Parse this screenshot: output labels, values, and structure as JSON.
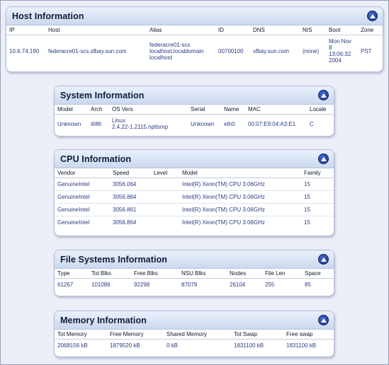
{
  "host": {
    "title": "Host Information",
    "headers": [
      "IP",
      "Host",
      "Alias",
      "ID",
      "DNS",
      "NIS",
      "Boot",
      "Zone"
    ],
    "row": {
      "ip": "10.6.74.190",
      "host": "federacre01-scs.sfbay.sun.com",
      "alias_lines": [
        "federacre01-scs",
        "localhost.localdomain",
        "localhost"
      ],
      "id": "00700100",
      "dns": "sfbay.sun.com",
      "nis": "(none)",
      "boot_lines": [
        "Mon Nov",
        "8",
        "13:06:32",
        "2004"
      ],
      "zone": "PST"
    }
  },
  "system": {
    "title": "System Information",
    "headers": [
      "Model",
      "Arch",
      "OS Vers",
      "Serial",
      "Name",
      "MAC",
      "Locale"
    ],
    "row": {
      "model": "Unknown",
      "arch": "i686",
      "os_lines": [
        "Linux",
        "2.4.22-1.2115.nptlsmp"
      ],
      "serial": "Unknown",
      "name": "eth0",
      "mac": "00:07:E9:04:A3:E1",
      "locale": "C"
    }
  },
  "cpu": {
    "title": "CPU Information",
    "headers": [
      "Vendor",
      "Speed",
      "Level",
      "Model",
      "Family"
    ],
    "rows": [
      {
        "vendor": "GenuineIntel",
        "speed": "3056.064",
        "level": "",
        "model": "Intel(R) Xeon(TM) CPU 3.06GHz",
        "family": "15"
      },
      {
        "vendor": "GenuineIntel",
        "speed": "3056.864",
        "level": "",
        "model": "Intel(R) Xeon(TM) CPU 3.06GHz",
        "family": "15"
      },
      {
        "vendor": "GenuineIntel",
        "speed": "3056.861",
        "level": "",
        "model": "Intel(R) Xeon(TM) CPU 3.06GHz",
        "family": "15"
      },
      {
        "vendor": "GenuineIntel",
        "speed": "3056.864",
        "level": "",
        "model": "Intel(R) Xeon(TM) CPU 3.06GHz",
        "family": "15"
      }
    ]
  },
  "fs": {
    "title": "File Systems Information",
    "headers": [
      "Type",
      "Tot Blks",
      "Free Blks",
      "NSU Blks",
      "Nodes",
      "File Len",
      "Space"
    ],
    "row": {
      "type": "61267",
      "tot": "101086",
      "free": "92298",
      "nsu": "87079",
      "nodes": "26104",
      "filelen": "255",
      "space": "85"
    }
  },
  "memory": {
    "title": "Memory Information",
    "headers": [
      "Tot Memory",
      "Free Memory",
      "Shared Memory",
      "Tot Swap",
      "Free swap"
    ],
    "row": {
      "tot": "2068156 kB",
      "free": "1879520 kB",
      "shared": "0 kB",
      "totswap": "1831100 kB",
      "freeswap": "1831100 kB"
    }
  }
}
